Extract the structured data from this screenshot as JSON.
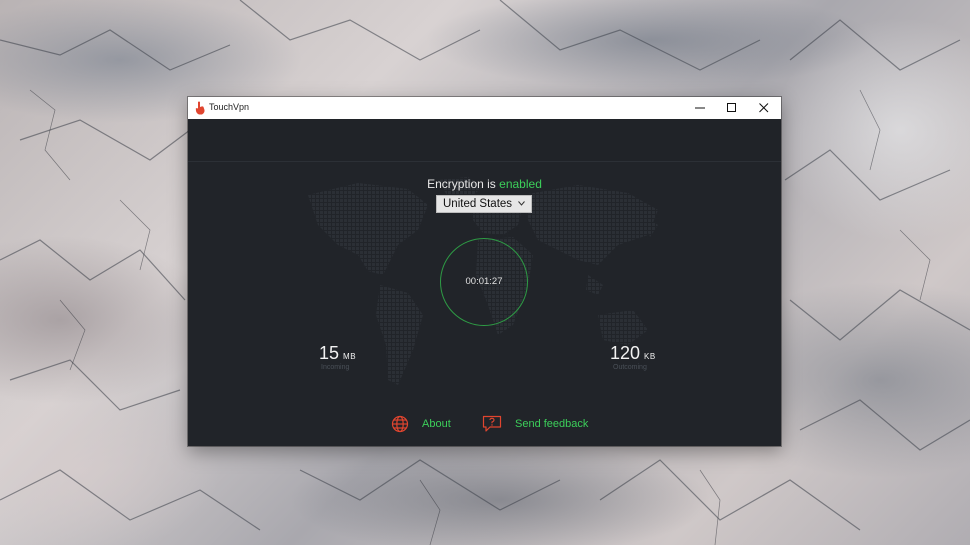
{
  "window": {
    "title": "TouchVpn"
  },
  "status": {
    "prefix": "Encryption is",
    "state": "enabled"
  },
  "country_select": {
    "selected": "United States"
  },
  "connection": {
    "timer": "00:01:27"
  },
  "stats": {
    "incoming": {
      "value": "15",
      "unit": "MB",
      "label": "Incoming"
    },
    "outgoing": {
      "value": "120",
      "unit": "KB",
      "label": "Outcoming"
    }
  },
  "footer": {
    "about_label": "About",
    "feedback_label": "Send feedback"
  },
  "colors": {
    "accent_green": "#3ccf5a",
    "accent_red": "#e0452f",
    "window_bg": "#212429"
  },
  "icons": {
    "app": "touchvpn-hand-icon",
    "about": "globe-icon",
    "feedback": "speech-bubble-question-icon"
  }
}
